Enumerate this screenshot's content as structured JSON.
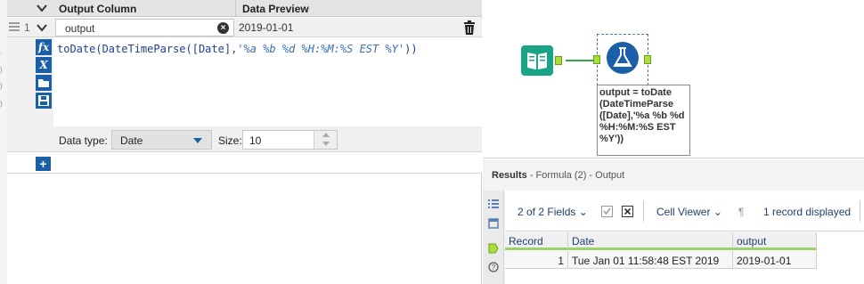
{
  "config": {
    "header": {
      "output_column": "Output Column",
      "data_preview": "Data Preview"
    },
    "row": {
      "number": "1",
      "output_name": "output",
      "preview": "2019-01-01",
      "expression_func": "toDate(DateTimeParse([Date],",
      "expression_string": "'%a %b %d %H:%M:%S EST %Y'",
      "expression_end": "))",
      "data_type_label": "Data type:",
      "data_type_value": "Date",
      "size_label": "Size:",
      "size_value": "10"
    },
    "editor_tools": [
      {
        "name": "fx-function-icon",
        "glyph": "fx"
      },
      {
        "name": "variables-icon",
        "glyph": "X"
      },
      {
        "name": "open-folder-icon",
        "glyph": ""
      },
      {
        "name": "save-icon",
        "glyph": ""
      }
    ],
    "add_button": "+"
  },
  "canvas": {
    "annotation": "output = toDate (DateTimeParse ([Date],'%a %b %d %H:%M:%S EST %Y'))"
  },
  "results": {
    "title": "Results",
    "subtitle": "- Formula (2) - Output",
    "fields_selector": "2 of 2 Fields",
    "cell_viewer": "Cell Viewer",
    "record_count": "1 record displayed",
    "columns": [
      "Record",
      "Date",
      "output"
    ],
    "rows": [
      [
        "1",
        "Tue Jan 01 11:58:48 EST 2019",
        "2019-01-01"
      ]
    ]
  },
  "colors": {
    "accent_blue": "#1a5fa8",
    "input_tool_teal": "#19a387",
    "anchor_green": "#a8e03a",
    "header_underline_green": "#9bd36b"
  }
}
